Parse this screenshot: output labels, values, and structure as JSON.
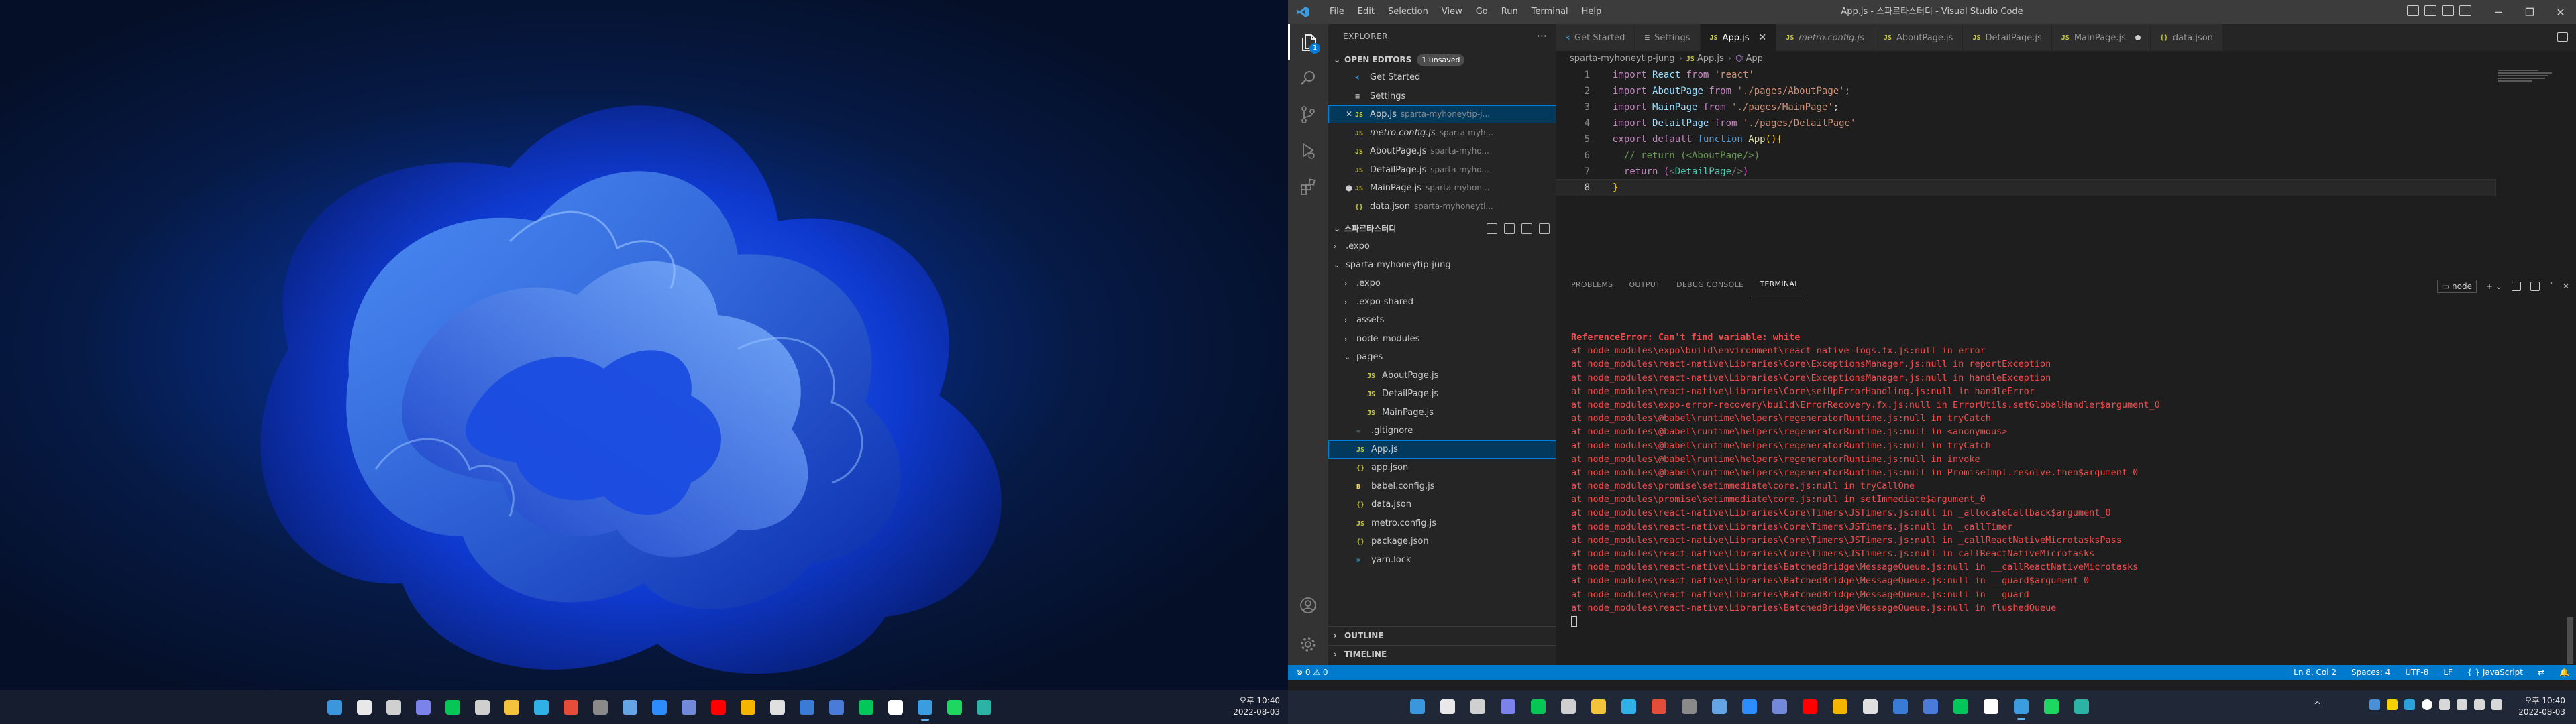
{
  "left_taskbar": {
    "clock_time": "오후 10:40",
    "clock_date": "2022-08-03",
    "apps": [
      {
        "icon": "windows-start-icon",
        "color": "#3a96dd"
      },
      {
        "icon": "search-icon",
        "color": "#e8e8e8"
      },
      {
        "icon": "task-view-icon",
        "color": "#d0d0d0"
      },
      {
        "icon": "teams-chat-icon",
        "color": "#7b83eb"
      },
      {
        "icon": "line-icon",
        "color": "#06c755"
      },
      {
        "icon": "calculator-icon",
        "color": "#cfcfcf"
      },
      {
        "icon": "file-explorer-icon",
        "color": "#f3c33c"
      },
      {
        "icon": "edge-icon",
        "color": "#2fb1e8"
      },
      {
        "icon": "chrome-icon",
        "color": "#e44d3a"
      },
      {
        "icon": "notepad-icon",
        "color": "#8a8a8a"
      },
      {
        "icon": "network-icon",
        "color": "#65a5e6"
      },
      {
        "icon": "zoom-icon",
        "color": "#2d8cff"
      },
      {
        "icon": "discord-icon",
        "color": "#7289da"
      },
      {
        "icon": "youtube-icon",
        "color": "#ff0000"
      },
      {
        "icon": "maps-icon",
        "color": "#f4b400"
      },
      {
        "icon": "photos-icon",
        "color": "#e0e0e0"
      },
      {
        "icon": "edit-icon",
        "color": "#3a7bd5"
      },
      {
        "icon": "mail-icon",
        "color": "#4a7bd8"
      },
      {
        "icon": "naver-icon",
        "color": "#03c75a"
      },
      {
        "icon": "notion-icon",
        "color": "#ffffff"
      },
      {
        "icon": "vscode-icon",
        "color": "#3b9de0",
        "active": true
      },
      {
        "icon": "spotify-icon",
        "color": "#1ed760"
      },
      {
        "icon": "sticky-notes-icon",
        "color": "#2db3a6"
      }
    ]
  },
  "titlebar": {
    "title": "App.js - 스파르타스터디 - Visual Studio Code",
    "menu": [
      "File",
      "Edit",
      "Selection",
      "View",
      "Go",
      "Run",
      "Terminal",
      "Help"
    ],
    "minimize": "─",
    "restore": "❐",
    "close": "✕"
  },
  "activity_bar": {
    "explorer_badge": "1"
  },
  "sidebar": {
    "title": "EXPLORER",
    "more": "···",
    "open_editors": {
      "label": "OPEN EDITORS",
      "badge": "1 unsaved",
      "items": [
        {
          "icon": "vs",
          "glyph": "≺",
          "name": "Get Started",
          "path": ""
        },
        {
          "icon": "gear",
          "glyph": "≡",
          "name": "Settings",
          "path": ""
        },
        {
          "icon": "js",
          "glyph": "JS",
          "name": "App.js",
          "path": "sparta-myhoneytip-j...",
          "lead": "✕",
          "selected": true
        },
        {
          "icon": "js",
          "glyph": "JS",
          "name": "metro.config.js",
          "path": "sparta-myh...",
          "italic": true
        },
        {
          "icon": "js",
          "glyph": "JS",
          "name": "AboutPage.js",
          "path": "sparta-myho..."
        },
        {
          "icon": "js",
          "glyph": "JS",
          "name": "DetailPage.js",
          "path": "sparta-myho..."
        },
        {
          "icon": "js",
          "glyph": "JS",
          "name": "MainPage.js",
          "path": "sparta-myhon...",
          "lead": "●"
        },
        {
          "icon": "json",
          "glyph": "{}",
          "name": "data.json",
          "path": "sparta-myhoneyti..."
        }
      ]
    },
    "folder": {
      "label": "스파르타스터디",
      "tree": [
        {
          "depth": 0,
          "chev": "›",
          "icon": "",
          "glyph": "",
          "name": ".expo"
        },
        {
          "depth": 0,
          "chev": "⌄",
          "icon": "",
          "glyph": "",
          "name": "sparta-myhoneytip-jung"
        },
        {
          "depth": 1,
          "chev": "›",
          "icon": "",
          "glyph": "",
          "name": ".expo"
        },
        {
          "depth": 1,
          "chev": "›",
          "icon": "",
          "glyph": "",
          "name": ".expo-shared"
        },
        {
          "depth": 1,
          "chev": "›",
          "icon": "",
          "glyph": "",
          "name": "assets"
        },
        {
          "depth": 1,
          "chev": "›",
          "icon": "",
          "glyph": "",
          "name": "node_modules"
        },
        {
          "depth": 1,
          "chev": "⌄",
          "icon": "",
          "glyph": "",
          "name": "pages"
        },
        {
          "depth": 2,
          "chev": "",
          "icon": "js",
          "glyph": "JS",
          "name": "AboutPage.js"
        },
        {
          "depth": 2,
          "chev": "",
          "icon": "js",
          "glyph": "JS",
          "name": "DetailPage.js"
        },
        {
          "depth": 2,
          "chev": "",
          "icon": "js",
          "glyph": "JS",
          "name": "MainPage.js"
        },
        {
          "depth": 1,
          "chev": "",
          "icon": "git",
          "glyph": "◆",
          "name": ".gitignore"
        },
        {
          "depth": 1,
          "chev": "",
          "icon": "js",
          "glyph": "JS",
          "name": "App.js",
          "selected": true
        },
        {
          "depth": 1,
          "chev": "",
          "icon": "json",
          "glyph": "{}",
          "name": "app.json"
        },
        {
          "depth": 1,
          "chev": "",
          "icon": "babel",
          "glyph": "B",
          "name": "babel.config.js"
        },
        {
          "depth": 1,
          "chev": "",
          "icon": "json",
          "glyph": "{}",
          "name": "data.json"
        },
        {
          "depth": 1,
          "chev": "",
          "icon": "js",
          "glyph": "JS",
          "name": "metro.config.js"
        },
        {
          "depth": 1,
          "chev": "",
          "icon": "json",
          "glyph": "{}",
          "name": "package.json"
        },
        {
          "depth": 1,
          "chev": "",
          "icon": "yarn",
          "glyph": "≋",
          "name": "yarn.lock"
        }
      ]
    },
    "outline": "OUTLINE",
    "timeline": "TIMELINE"
  },
  "tabs": [
    {
      "icon": "vs",
      "glyph": "≺",
      "label": "Get Started"
    },
    {
      "icon": "gear",
      "glyph": "≡",
      "label": "Settings"
    },
    {
      "icon": "js",
      "glyph": "JS",
      "label": "App.js",
      "active": true,
      "close": "✕"
    },
    {
      "icon": "js",
      "glyph": "JS",
      "label": "metro.config.js",
      "italic": true
    },
    {
      "icon": "js",
      "glyph": "JS",
      "label": "AboutPage.js"
    },
    {
      "icon": "js",
      "glyph": "JS",
      "label": "DetailPage.js"
    },
    {
      "icon": "js",
      "glyph": "JS",
      "label": "MainPage.js",
      "dirty": true
    },
    {
      "icon": "json",
      "glyph": "{}",
      "label": "data.json"
    }
  ],
  "breadcrumb": {
    "folder": "sparta-myhoneytip-jung",
    "file": "App.js",
    "symbol": "App"
  },
  "editor": {
    "current_line": 8,
    "lines": [
      {
        "n": "1",
        "tokens": [
          [
            "kw",
            "import "
          ],
          [
            "vn",
            "React "
          ],
          [
            "kw",
            "from "
          ],
          [
            "st",
            "'react'"
          ]
        ]
      },
      {
        "n": "2",
        "tokens": [
          [
            "kw",
            "import "
          ],
          [
            "vn",
            "AboutPage "
          ],
          [
            "kw",
            "from "
          ],
          [
            "st",
            "'./pages/AboutPage'"
          ],
          [
            "d",
            ";"
          ]
        ]
      },
      {
        "n": "3",
        "tokens": [
          [
            "kw",
            "import "
          ],
          [
            "vn",
            "MainPage "
          ],
          [
            "kw",
            "from "
          ],
          [
            "st",
            "'./pages/MainPage'"
          ],
          [
            "d",
            ";"
          ]
        ]
      },
      {
        "n": "4",
        "tokens": [
          [
            "kw",
            "import "
          ],
          [
            "vn",
            "DetailPage "
          ],
          [
            "kw",
            "from "
          ],
          [
            "st",
            "'./pages/DetailPage'"
          ]
        ]
      },
      {
        "n": "5",
        "tokens": [
          [
            "kw",
            "export default "
          ],
          [
            "kb",
            "function "
          ],
          [
            "fn",
            "App"
          ],
          [
            "br1",
            "()"
          ],
          [
            "br1",
            "{"
          ]
        ]
      },
      {
        "n": "6",
        "tokens": [
          [
            "cm",
            "  // return (<AboutPage/>)"
          ]
        ]
      },
      {
        "n": "7",
        "tokens": [
          [
            "kw",
            "  return "
          ],
          [
            "br2",
            "("
          ],
          [
            "pu",
            "<"
          ],
          [
            "tg",
            "DetailPage"
          ],
          [
            "pu",
            "/>"
          ],
          [
            "br2",
            ")"
          ]
        ]
      },
      {
        "n": "8",
        "tokens": [
          [
            "br1",
            "}"
          ]
        ]
      }
    ]
  },
  "panel": {
    "tabs": [
      "PROBLEMS",
      "OUTPUT",
      "DEBUG CONSOLE",
      "TERMINAL"
    ],
    "active_tab": "TERMINAL",
    "process": "node",
    "add": "+ ⌄",
    "terminal_lines": [
      "ReferenceError: Can't find variable: white",
      "at node_modules\\expo\\build\\environment\\react-native-logs.fx.js:null in error",
      "at node_modules\\react-native\\Libraries\\Core\\ExceptionsManager.js:null in reportException",
      "at node_modules\\react-native\\Libraries\\Core\\ExceptionsManager.js:null in handleException",
      "at node_modules\\react-native\\Libraries\\Core\\setUpErrorHandling.js:null in handleError",
      "at node_modules\\expo-error-recovery\\build\\ErrorRecovery.fx.js:null in ErrorUtils.setGlobalHandler$argument_0",
      "at node_modules\\@babel\\runtime\\helpers\\regeneratorRuntime.js:null in tryCatch",
      "at node_modules\\@babel\\runtime\\helpers\\regeneratorRuntime.js:null in <anonymous>",
      "at node_modules\\@babel\\runtime\\helpers\\regeneratorRuntime.js:null in tryCatch",
      "at node_modules\\@babel\\runtime\\helpers\\regeneratorRuntime.js:null in invoke",
      "at node_modules\\@babel\\runtime\\helpers\\regeneratorRuntime.js:null in PromiseImpl.resolve.then$argument_0",
      "at node_modules\\promise\\setimmediate\\core.js:null in tryCallOne",
      "at node_modules\\promise\\setimmediate\\core.js:null in setImmediate$argument_0",
      "at node_modules\\react-native\\Libraries\\Core\\Timers\\JSTimers.js:null in _allocateCallback$argument_0",
      "at node_modules\\react-native\\Libraries\\Core\\Timers\\JSTimers.js:null in _callTimer",
      "at node_modules\\react-native\\Libraries\\Core\\Timers\\JSTimers.js:null in _callReactNativeMicrotasksPass",
      "at node_modules\\react-native\\Libraries\\Core\\Timers\\JSTimers.js:null in callReactNativeMicrotasks",
      "at node_modules\\react-native\\Libraries\\BatchedBridge\\MessageQueue.js:null in __callReactNativeMicrotasks",
      "at node_modules\\react-native\\Libraries\\BatchedBridge\\MessageQueue.js:null in __guard$argument_0",
      "at node_modules\\react-native\\Libraries\\BatchedBridge\\MessageQueue.js:null in __guard",
      "at node_modules\\react-native\\Libraries\\BatchedBridge\\MessageQueue.js:null in flushedQueue"
    ]
  },
  "statusbar": {
    "problems": "⊗ 0 ⚠ 0",
    "position": "Ln 8, Col 2",
    "spaces": "Spaces: 4",
    "encoding": "UTF-8",
    "eol": "LF",
    "language": "{ } JavaScript"
  },
  "right_taskbar": {
    "clock_time": "오후 10:40",
    "clock_date": "2022-08-03",
    "apps": [
      {
        "icon": "windows-start-icon",
        "color": "#3a96dd"
      },
      {
        "icon": "search-icon",
        "color": "#e8e8e8"
      },
      {
        "icon": "task-view-icon",
        "color": "#d0d0d0"
      },
      {
        "icon": "teams-chat-icon",
        "color": "#7b83eb"
      },
      {
        "icon": "line-icon",
        "color": "#06c755"
      },
      {
        "icon": "calculator-icon",
        "color": "#cfcfcf"
      },
      {
        "icon": "file-explorer-icon",
        "color": "#f3c33c"
      },
      {
        "icon": "edge-icon",
        "color": "#2fb1e8"
      },
      {
        "icon": "chrome-icon",
        "color": "#e44d3a"
      },
      {
        "icon": "notepad-icon",
        "color": "#8a8a8a"
      },
      {
        "icon": "network-icon",
        "color": "#65a5e6"
      },
      {
        "icon": "zoom-icon",
        "color": "#2d8cff"
      },
      {
        "icon": "discord-icon",
        "color": "#7289da"
      },
      {
        "icon": "youtube-icon",
        "color": "#ff0000"
      },
      {
        "icon": "maps-icon",
        "color": "#f4b400"
      },
      {
        "icon": "photos-icon",
        "color": "#e0e0e0"
      },
      {
        "icon": "edit-icon",
        "color": "#3a7bd5"
      },
      {
        "icon": "mail-icon",
        "color": "#4a7bd8"
      },
      {
        "icon": "naver-icon",
        "color": "#03c75a"
      },
      {
        "icon": "notion-icon",
        "color": "#ffffff"
      },
      {
        "icon": "vscode-icon",
        "color": "#3b9de0",
        "active": true
      },
      {
        "icon": "spotify-icon",
        "color": "#1ed760"
      },
      {
        "icon": "sticky-notes-icon",
        "color": "#2db3a6"
      }
    ],
    "tray_chevron": "^"
  }
}
